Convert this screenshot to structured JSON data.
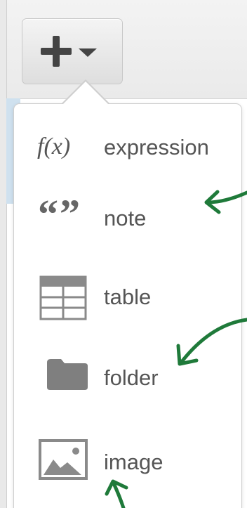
{
  "toolbar": {
    "add_button": {
      "icon": "plus-icon",
      "caret": "chevron-down-icon"
    }
  },
  "menu": {
    "items": [
      {
        "icon": "function-icon",
        "icon_text": "f(x)",
        "label": "expression"
      },
      {
        "icon": "quote-icon",
        "icon_text": "“”",
        "label": "note"
      },
      {
        "icon": "table-icon",
        "label": "table"
      },
      {
        "icon": "folder-icon",
        "label": "folder"
      },
      {
        "icon": "image-icon",
        "label": "image"
      }
    ]
  },
  "colors": {
    "menu_text": "#555555",
    "icon_gray": "#7f7f7f",
    "annotation_arrow": "#1f7a3a",
    "toolbar_bg": "#eeeeee",
    "accent_strip": "#cfe1ef"
  }
}
